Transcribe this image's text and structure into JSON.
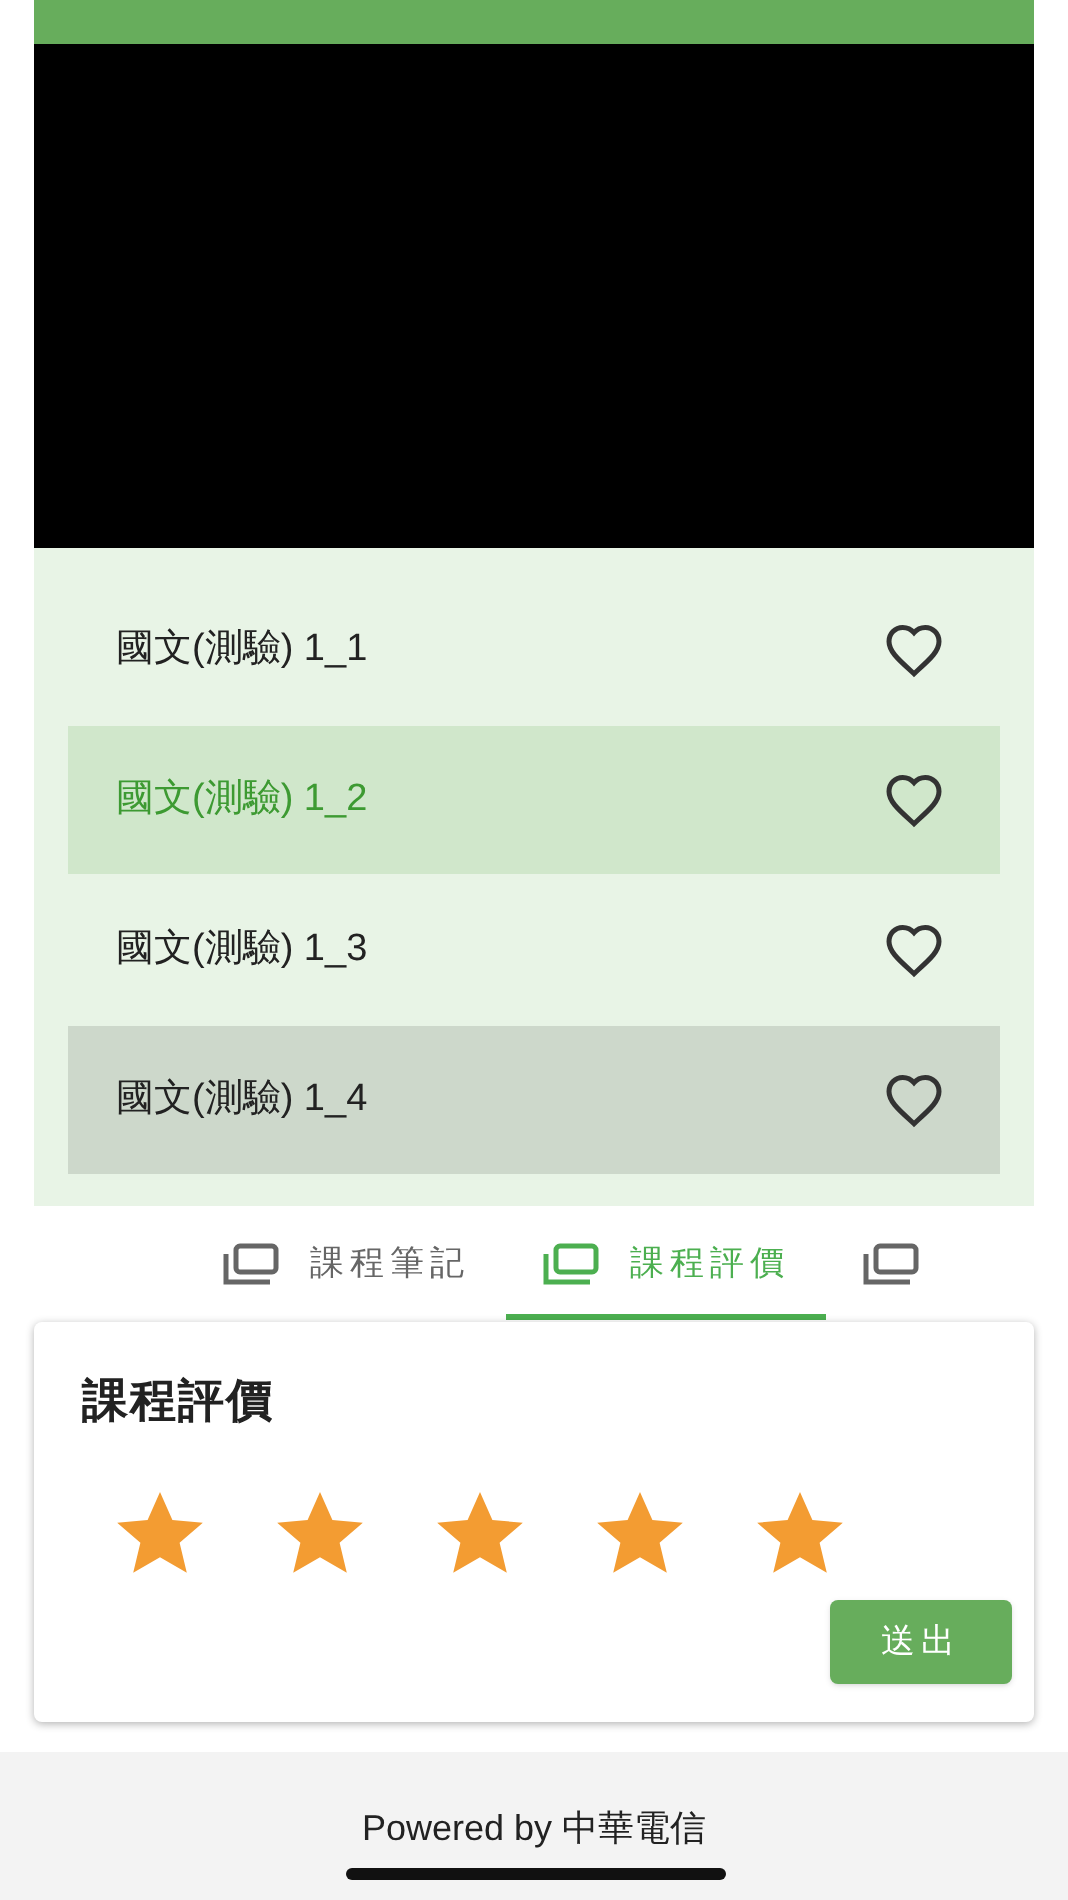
{
  "lessons": [
    {
      "title": "國文(測驗) 1_1",
      "selected": false,
      "highlighted": false,
      "favorite": false
    },
    {
      "title": "國文(測驗) 1_2",
      "selected": true,
      "highlighted": false,
      "favorite": false
    },
    {
      "title": "國文(測驗) 1_3",
      "selected": false,
      "highlighted": false,
      "favorite": false
    },
    {
      "title": "國文(測驗) 1_4",
      "selected": false,
      "highlighted": true,
      "favorite": false
    }
  ],
  "tabs": [
    {
      "label": "課程筆記",
      "selected": false
    },
    {
      "label": "課程評價",
      "selected": true
    },
    {
      "selected": false
    }
  ],
  "rating": {
    "title": "課程評價",
    "stars": 5,
    "submit": "送出"
  },
  "footer": "Powered by 中華電信"
}
